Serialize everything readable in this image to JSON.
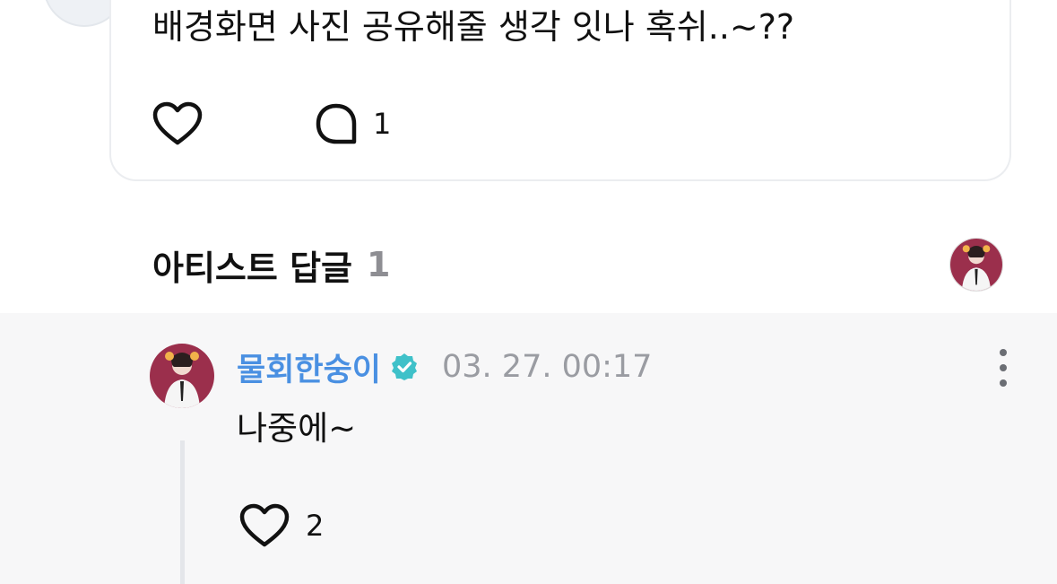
{
  "comment": {
    "text": "배경화면 사진 공유해줄 생각 잇나 혹쉬..~??",
    "like_icon": "heart-outline-icon",
    "reply_icon": "speech-bubble-icon",
    "reply_count": "1"
  },
  "artist_replies": {
    "title": "아티스트 답글",
    "count": "1",
    "avatar_icon": "artist-avatar"
  },
  "reply": {
    "author": "물회한숭이",
    "verified_icon": "verified-badge-icon",
    "timestamp": "03. 27. 00:17",
    "text": "나중에~",
    "like_count": "2",
    "more_icon": "more-vertical-icon"
  },
  "colors": {
    "author_name": "#4a90e2",
    "verified_badge": "#3fc1c9",
    "timestamp": "#9a9ca2",
    "reply_background": "#f7f7f8",
    "count_gray": "#8e8e93"
  }
}
